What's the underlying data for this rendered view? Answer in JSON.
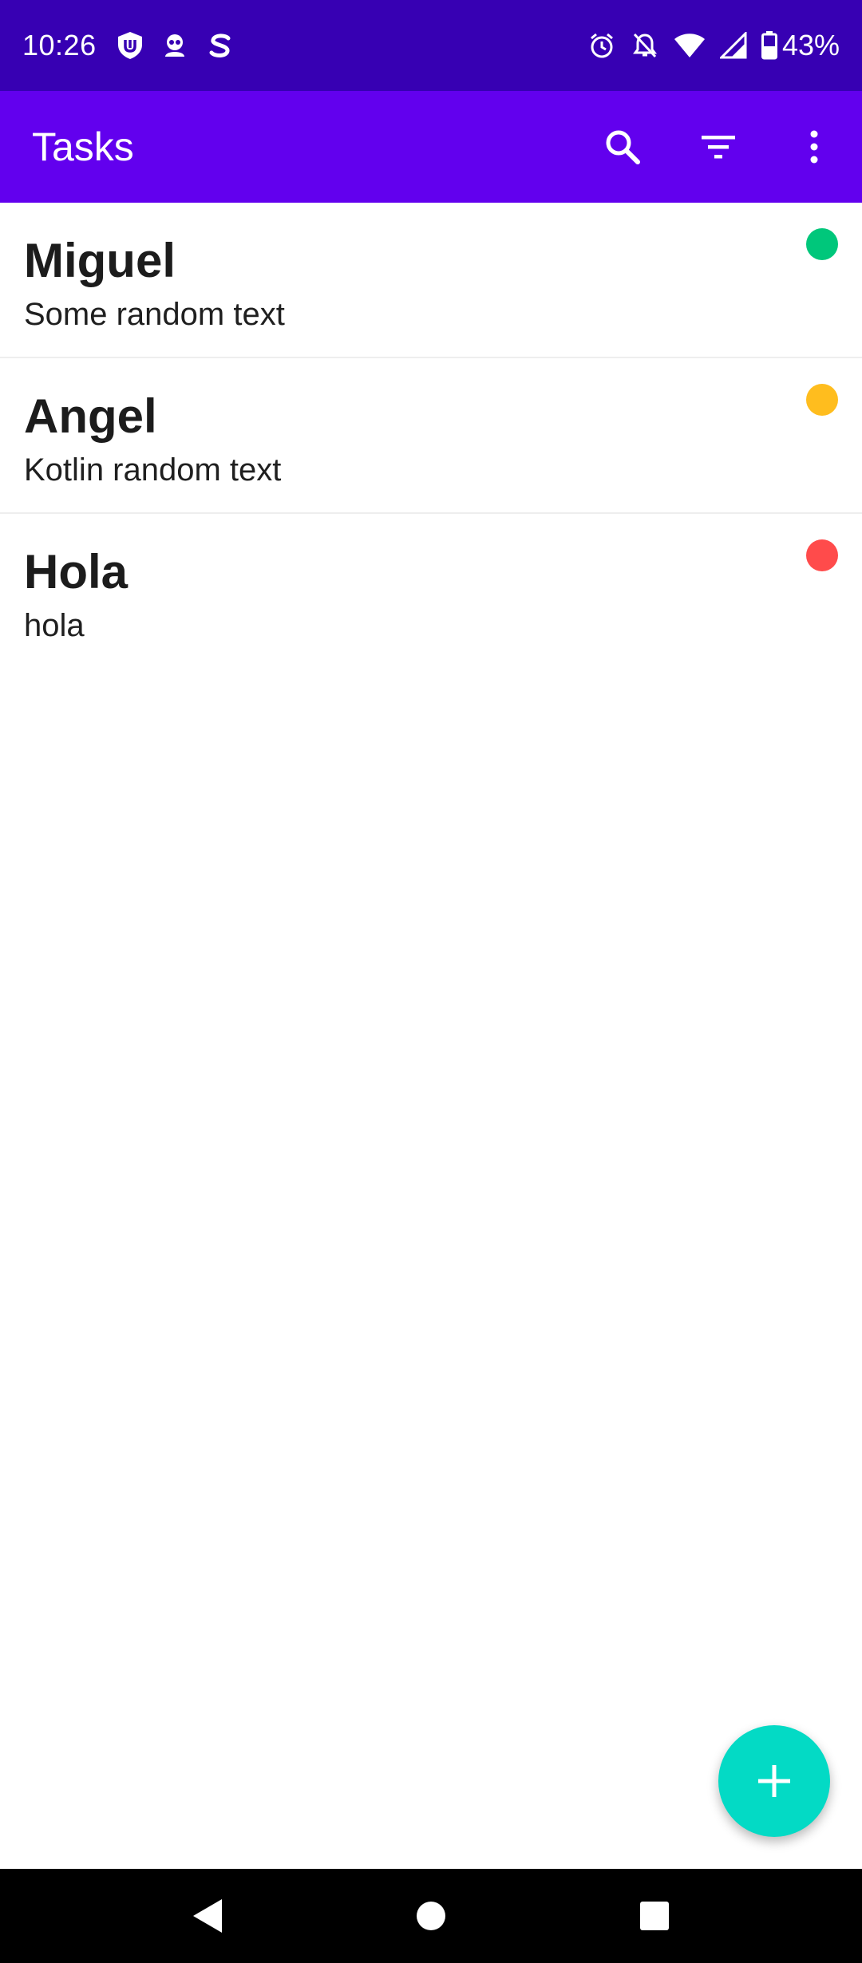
{
  "status_bar": {
    "time": "10:26",
    "battery": "43%",
    "left_icons": [
      "shield-icon",
      "incognito-icon",
      "s-logo-icon"
    ],
    "right_icons": [
      "alarm-icon",
      "bell-off-icon",
      "wifi-icon",
      "signal-icon",
      "battery-icon"
    ]
  },
  "app_bar": {
    "title": "Tasks",
    "actions": [
      "search-icon",
      "filter-icon",
      "more-vert-icon"
    ]
  },
  "tasks": [
    {
      "title": "Miguel",
      "description": "Some random text",
      "priority_color": "#00c77b"
    },
    {
      "title": "Angel",
      "description": "Kotlin random text",
      "priority_color": "#ffbd1e"
    },
    {
      "title": "Hola",
      "description": "hola",
      "priority_color": "#ff4b4b"
    }
  ],
  "fab": {
    "icon": "plus-icon"
  },
  "nav_bar": {
    "buttons": [
      "back-icon",
      "home-icon",
      "recents-icon"
    ]
  },
  "colors": {
    "status_bar": "#3700b3",
    "app_bar": "#6200ee",
    "fab": "#03dac5"
  }
}
